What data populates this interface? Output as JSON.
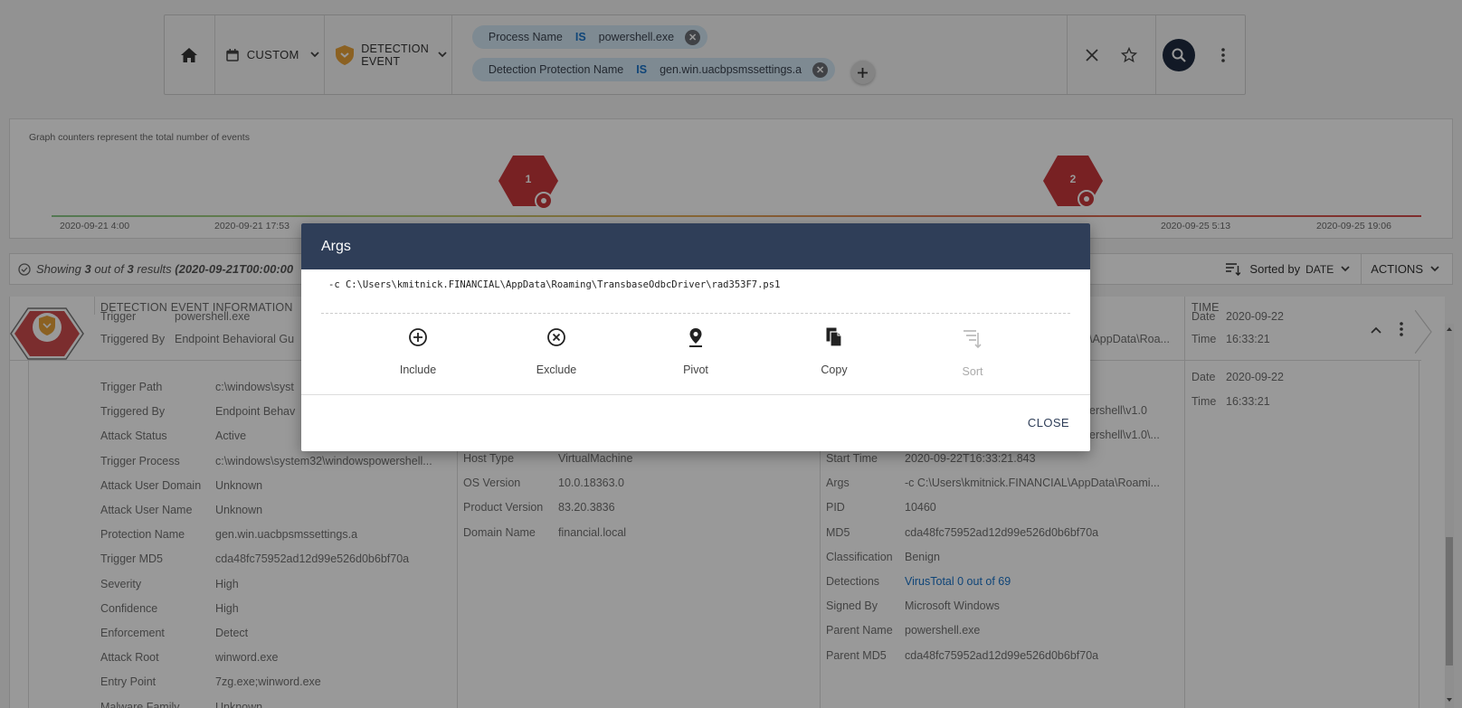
{
  "search": {
    "date_label": "CUSTOM",
    "event_type_line1": "DETECTION",
    "event_type_line2": "EVENT",
    "chips": [
      {
        "field": "Process Name",
        "op": "IS",
        "value": "powershell.exe"
      },
      {
        "field": "Detection Protection Name",
        "op": "IS",
        "value": "gen.win.uacbpsmssettings.a"
      }
    ]
  },
  "graph": {
    "note": "Graph counters represent the total number of events",
    "markers": [
      {
        "count": "1"
      },
      {
        "count": "2"
      }
    ],
    "ticks": [
      "2020-09-21 4:00",
      "2020-09-21 17:53",
      "2020-09-25 5:13",
      "2020-09-25 19:06"
    ]
  },
  "results": {
    "showing": "Showing",
    "count": "3",
    "out_of": "out of",
    "total": "3",
    "results_word": "results",
    "range": "(2020-09-21T00:00:00",
    "sorted_by": "Sorted by",
    "sort_field": "DATE",
    "actions": "ACTIONS"
  },
  "table": {
    "col_detection": "DETECTION EVENT INFORMATION",
    "col_time": "TIME",
    "partial_row": [
      {
        "k": "Trigger",
        "v": "powershell.exe"
      },
      {
        "k": "Triggered By",
        "v": "Endpoint Behavioral Gu"
      }
    ],
    "partial_right": "\\AppData\\Roa...",
    "partial_time": [
      {
        "k": "Date",
        "v": "2020-09-22"
      },
      {
        "k": "Time",
        "v": "16:33:21"
      }
    ],
    "detail_time": [
      {
        "k": "Date",
        "v": "2020-09-22"
      },
      {
        "k": "Time",
        "v": "16:33:21"
      }
    ],
    "left_rows": [
      {
        "k": "Trigger Path",
        "v": "c:\\windows\\syst"
      },
      {
        "k": "Triggered By",
        "v": "Endpoint Behav"
      },
      {
        "k": "Attack Status",
        "v": "Active"
      },
      {
        "k": "Trigger Process",
        "v": "c:\\windows\\system32\\windowspowershell..."
      },
      {
        "k": "Attack User Domain",
        "v": "Unknown"
      },
      {
        "k": "Attack User Name",
        "v": "Unknown"
      },
      {
        "k": "Protection Name",
        "v": "gen.win.uacbpsmssettings.a"
      },
      {
        "k": "Trigger MD5",
        "v": "cda48fc75952ad12d99e526d0b6bf70a"
      },
      {
        "k": "Severity",
        "v": "High"
      },
      {
        "k": "Confidence",
        "v": "High"
      },
      {
        "k": "Enforcement",
        "v": "Detect"
      },
      {
        "k": "Attack Root",
        "v": "winword.exe"
      },
      {
        "k": "Entry Point",
        "v": "7zg.exe;winword.exe"
      },
      {
        "k": "Malware Family",
        "v": "Unknown"
      }
    ],
    "mid_rows": [
      {
        "k": "Host Type",
        "v": "VirtualMachine"
      },
      {
        "k": "OS Version",
        "v": "10.0.18363.0"
      },
      {
        "k": "Product Version",
        "v": "83.20.3836"
      },
      {
        "k": "Domain Name",
        "v": "financial.local"
      }
    ],
    "right_partial": [
      {
        "v": "ershell\\v1.0"
      },
      {
        "v": "ershell\\v1.0\\..."
      }
    ],
    "right_rows": [
      {
        "k": "Start Time",
        "v": "2020-09-22T16:33:21.843"
      },
      {
        "k": "Args",
        "v": "-c C:\\Users\\kmitnick.FINANCIAL\\AppData\\Roami..."
      },
      {
        "k": "PID",
        "v": "10460"
      },
      {
        "k": "MD5",
        "v": "cda48fc75952ad12d99e526d0b6bf70a"
      },
      {
        "k": "Classification",
        "v": "Benign"
      },
      {
        "k": "Detections",
        "v": "VirusTotal 0 out of 69"
      },
      {
        "k": "Signed By",
        "v": "Microsoft Windows"
      },
      {
        "k": "Parent Name",
        "v": "powershell.exe"
      },
      {
        "k": "Parent MD5",
        "v": "cda48fc75952ad12d99e526d0b6bf70a"
      }
    ]
  },
  "dialog": {
    "title": "Args",
    "value": "-c C:\\Users\\kmitnick.FINANCIAL\\AppData\\Roaming\\TransbaseOdbcDriver\\rad353F7.ps1",
    "actions": [
      "Include",
      "Exclude",
      "Pivot",
      "Copy",
      "Sort"
    ],
    "close": "CLOSE"
  },
  "colors": {
    "header": "#2f3e58",
    "link": "#1a73c9",
    "marker": "#c9383b"
  }
}
